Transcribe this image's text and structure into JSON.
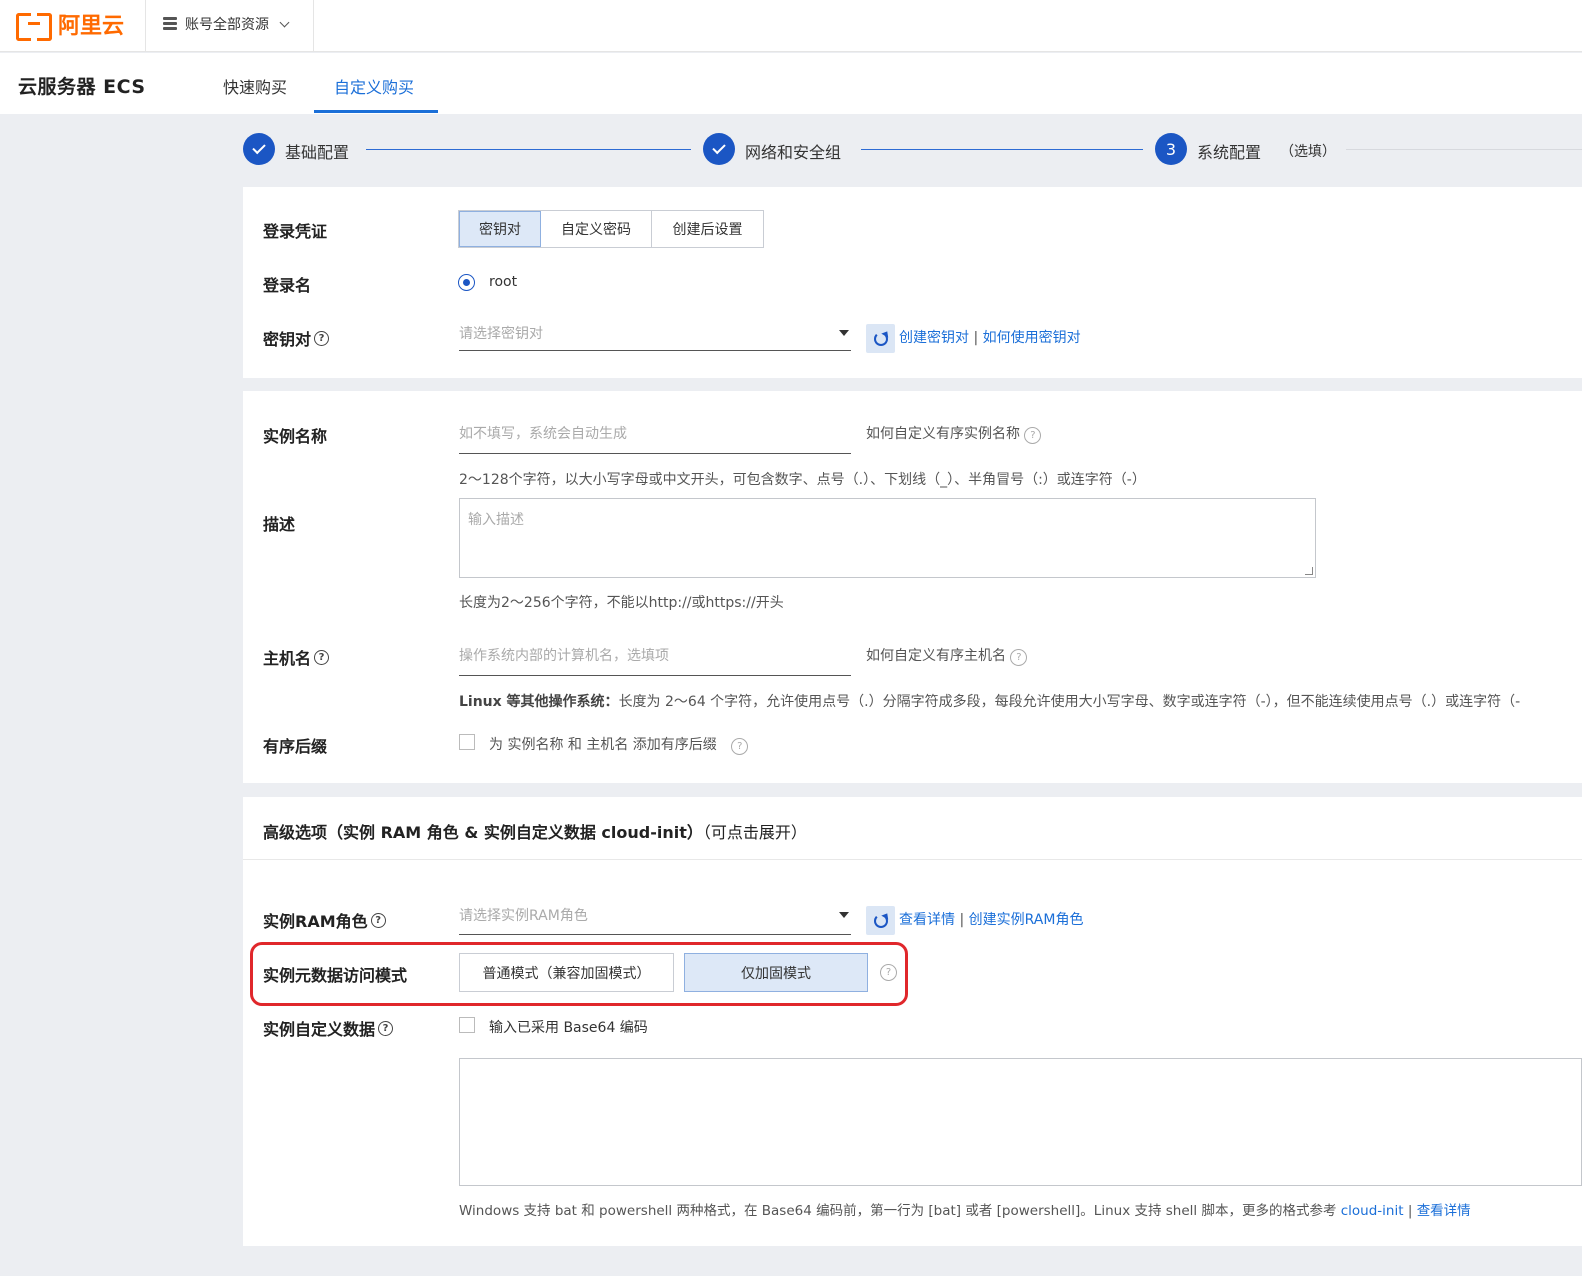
{
  "topbar": {
    "logo_text": "阿里云",
    "resource_selector": "账号全部资源"
  },
  "header": {
    "product_title": "云服务器 ECS",
    "tabs": [
      {
        "label": "快速购买",
        "active": false
      },
      {
        "label": "自定义购买",
        "active": true
      }
    ]
  },
  "steps": [
    {
      "label": "基础配置",
      "state": "done"
    },
    {
      "label": "网络和安全组",
      "state": "done"
    },
    {
      "number": "3",
      "label": "系统配置",
      "optional": "（选填）",
      "state": "current"
    }
  ],
  "login": {
    "credential_label": "登录凭证",
    "credential_options": [
      "密钥对",
      "自定义密码",
      "创建后设置"
    ],
    "credential_selected": "密钥对",
    "login_name_label": "登录名",
    "login_name_value": "root",
    "keypair_label": "密钥对",
    "keypair_placeholder": "请选择密钥对",
    "keypair_link_create": "创建密钥对",
    "link_sep": "|",
    "keypair_link_howto": "如何使用密钥对"
  },
  "instance": {
    "name_label": "实例名称",
    "name_placeholder": "如不填写，系统会自动生成",
    "name_help_link": "如何自定义有序实例名称",
    "name_hint": "2～128个字符，以大小写字母或中文开头，可包含数字、点号（.）、下划线（_）、半角冒号（:）或连字符（-）",
    "desc_label": "描述",
    "desc_placeholder": "输入描述",
    "desc_hint": "长度为2～256个字符，不能以http://或https://开头",
    "hostname_label": "主机名",
    "hostname_placeholder": "操作系统内部的计算机名，选填项",
    "hostname_help_link": "如何自定义有序主机名",
    "hostname_hint_bold": "Linux 等其他操作系统：",
    "hostname_hint": "长度为 2～64 个字符，允许使用点号（.）分隔字符成多段，每段允许使用大小写字母、数字或连字符（-），但不能连续使用点号（.）或连字符（-",
    "suffix_label": "有序后缀",
    "suffix_checkbox_label": "为 实例名称 和 主机名 添加有序后缀"
  },
  "advanced": {
    "title_bold": "高级选项（实例 RAM 角色 & 实例自定义数据 cloud-init）",
    "title_note": "（可点击展开）",
    "ram_label": "实例RAM角色",
    "ram_placeholder": "请选择实例RAM角色",
    "ram_link_details": "查看详情",
    "ram_link_create": "创建实例RAM角色",
    "metadata_label": "实例元数据访问模式",
    "metadata_options": [
      "普通模式（兼容加固模式）",
      "仅加固模式"
    ],
    "metadata_selected": "仅加固模式",
    "userdata_label": "实例自定义数据",
    "userdata_checkbox_label": "输入已采用 Base64 编码",
    "userdata_hint": "Windows 支持 bat 和 powershell 两种格式，在 Base64 编码前，第一行为 [bat] 或者 [powershell]。Linux 支持 shell 脚本，更多的格式参考",
    "userdata_link_cloudinit": "cloud-init",
    "userdata_link_details": "查看详情"
  },
  "colors": {
    "brand": "#ff6a00",
    "accent": "#1b6fd8",
    "step": "#1b56c4",
    "highlight": "#e0272b"
  }
}
